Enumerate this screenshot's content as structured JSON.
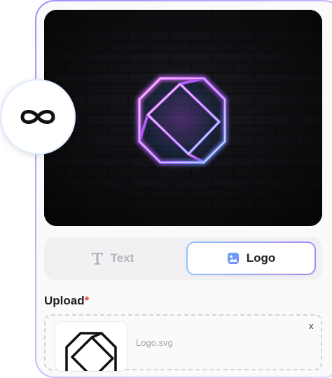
{
  "icons": {
    "loop": "infinity-icon",
    "text_tab": "text-t-icon",
    "logo_tab": "image-icon",
    "neon_logo": "neon-logo"
  },
  "tabs": {
    "text_label": "Text",
    "logo_label": "Logo",
    "selected": "Logo"
  },
  "upload": {
    "label": "Upload",
    "required_mark": "*",
    "file_name": "Logo.svg",
    "remove_label": "x"
  },
  "colors": {
    "neon_start": "#d946ef",
    "neon_end": "#3b82f6",
    "required": "#ef4444"
  }
}
